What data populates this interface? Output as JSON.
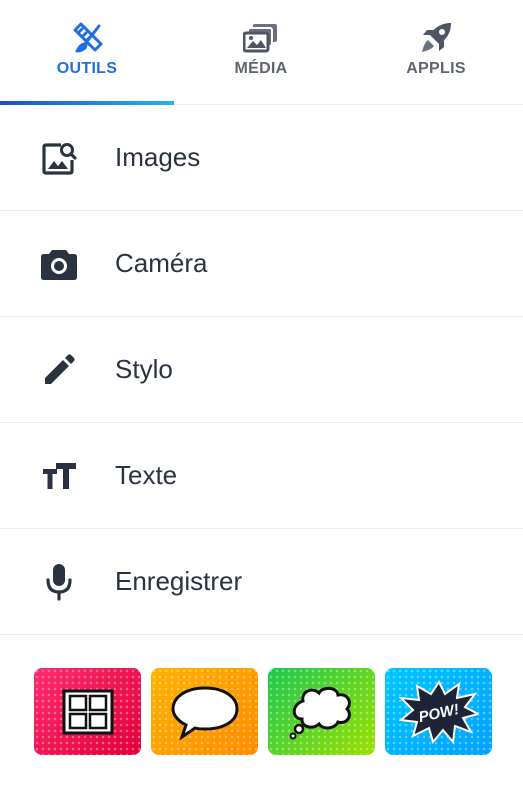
{
  "tabs": [
    {
      "label": "OUTILS",
      "icon": "brush-ruler-icon",
      "active": true
    },
    {
      "label": "MÉDIA",
      "icon": "media-icon",
      "active": false
    },
    {
      "label": "APPLIS",
      "icon": "rocket-icon",
      "active": false
    }
  ],
  "menu": [
    {
      "label": "Images",
      "icon": "image-search-icon"
    },
    {
      "label": "Caméra",
      "icon": "camera-icon"
    },
    {
      "label": "Stylo",
      "icon": "pen-icon"
    },
    {
      "label": "Texte",
      "icon": "text-size-icon"
    },
    {
      "label": "Enregistrer",
      "icon": "microphone-icon"
    }
  ],
  "stickers": [
    {
      "name": "comic-panel-grid",
      "icon": "grid-panel-icon",
      "color": "#e0003a"
    },
    {
      "name": "speech-bubble",
      "icon": "speech-bubble-icon",
      "color": "#ffb300"
    },
    {
      "name": "thought-bubble",
      "icon": "thought-bubble-icon",
      "color": "#1ec850"
    },
    {
      "name": "pow-burst",
      "icon": "pow-burst-icon",
      "text": "POW!",
      "color": "#00c6ff"
    }
  ],
  "colors": {
    "accent": "#1f6fe0",
    "text": "#2b3240",
    "inactive_tab": "#5f6570"
  }
}
